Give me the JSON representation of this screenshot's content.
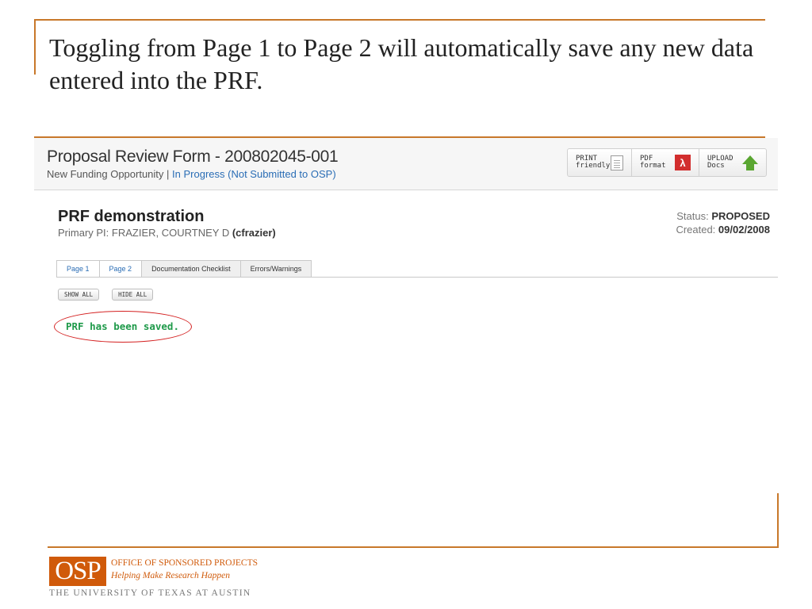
{
  "slide": {
    "heading": "Toggling from Page 1 to Page 2 will automatically save any new data entered into the PRF."
  },
  "form": {
    "title": "Proposal Review Form - 200802045-001",
    "subtitle_type": "New Funding Opportunity",
    "subtitle_sep": " | ",
    "subtitle_status": "In Progress (Not Submitted to OSP)",
    "toolbar": [
      {
        "label_line1": "PRINT",
        "label_line2": "friendly",
        "icon": "document-icon"
      },
      {
        "label_line1": "PDF",
        "label_line2": "format",
        "icon": "pdf-icon"
      },
      {
        "label_line1": "UPLOAD",
        "label_line2": "Docs",
        "icon": "upload-arrow-icon"
      }
    ],
    "prf_title": "PRF demonstration",
    "pi_label": "Primary PI: FRAZIER, COURTNEY D ",
    "pi_id": "(cfrazier)",
    "status_label": "Status: ",
    "status_value": "PROPOSED",
    "created_label": "Created: ",
    "created_value": "09/02/2008",
    "tabs": [
      "Page 1",
      "Page 2",
      "Documentation Checklist",
      "Errors/Warnings"
    ],
    "active_tab": "Page 1",
    "show_all": "SHOW ALL",
    "hide_all": "HIDE ALL",
    "saved_message": "PRF has been saved."
  },
  "footer": {
    "logo_text": "OSP",
    "line1": "OFFICE OF SPONSORED PROJECTS",
    "line2": "Helping Make Research Happen",
    "university": "THE UNIVERSITY OF TEXAS AT AUSTIN"
  },
  "colors": {
    "accent_rule": "#c8782a",
    "link": "#2a6db5",
    "saved_green": "#1f9a4a",
    "highlight_red": "#d42020",
    "osp_orange": "#d05a0a"
  }
}
